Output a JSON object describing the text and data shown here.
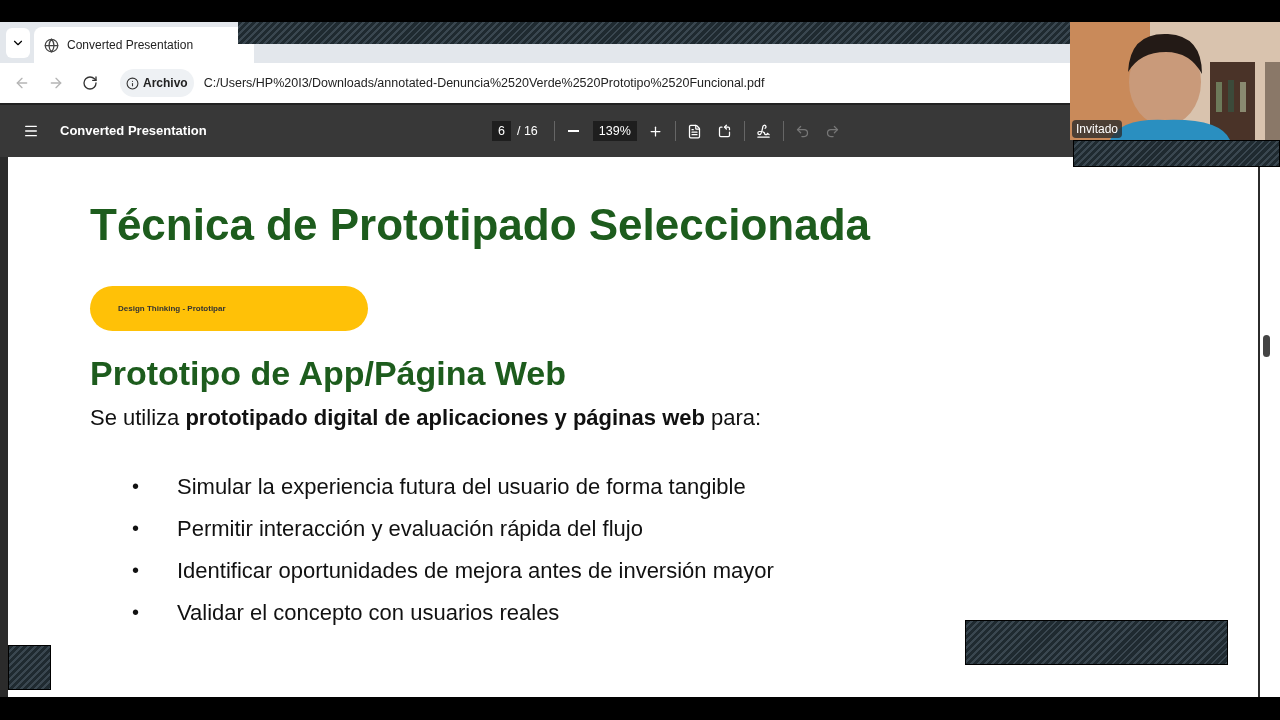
{
  "browser": {
    "tabs": [
      {
        "title": "Converted Presentation",
        "selected": true
      }
    ],
    "nav": [
      {
        "kind": "back",
        "disabled": true
      },
      {
        "kind": "forward",
        "disabled": true
      },
      {
        "kind": "reload",
        "disabled": false
      }
    ],
    "site_label": "Archivo",
    "url": "C:/Users/HP%20I3/Downloads/annotated-Denuncia%2520Verde%2520Prototipo%2520Funcional.pdf"
  },
  "pdf_toolbar": {
    "title": "Converted Presentation",
    "page": "6",
    "total": "/ 16",
    "zoom": "139%",
    "tools": [
      {
        "kind": "fit",
        "disabled": false
      },
      {
        "kind": "rotate",
        "disabled": false
      },
      {
        "kind": "draw",
        "disabled": false
      },
      {
        "kind": "undo",
        "disabled": true
      },
      {
        "kind": "redo",
        "disabled": true
      }
    ]
  },
  "slide": {
    "title": "Técnica de Prototipado Seleccionada",
    "tag": "Design Thinking - Prototipar",
    "subtitle": "Prototipo de App/Página Web",
    "intro": "Se utiliza **prototipado digital de aplicaciones y páginas web** para:",
    "bullets": [
      {
        "marker": "•",
        "text": "Simular la experiencia futura del usuario de forma tangible"
      },
      {
        "marker": "•",
        "text": "Permitir interacción y evaluación rápida del flujo"
      },
      {
        "marker": "•",
        "text": "Identificar oportunidades de mejora antes de inversión mayor"
      },
      {
        "marker": "•",
        "text": "Validar el concepto con usuarios reales"
      }
    ]
  },
  "webcam": {
    "label": "Invitado"
  }
}
